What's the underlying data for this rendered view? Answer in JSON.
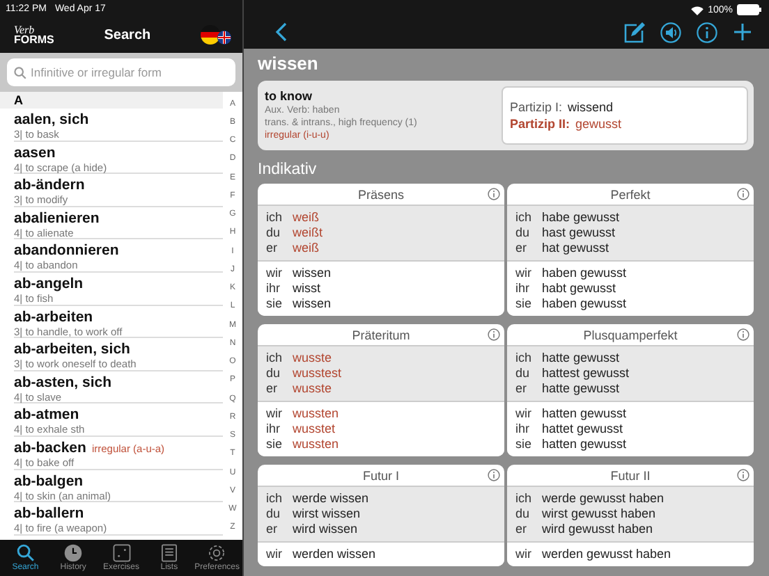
{
  "status_bar": {
    "time": "11:22 PM",
    "date": "Wed Apr 17",
    "battery": "100%"
  },
  "sidebar": {
    "logo_top": "Verb",
    "logo_bottom": "FORMS",
    "title": "Search",
    "search": {
      "placeholder": "Infinitive or irregular form"
    },
    "section": "A",
    "items": [
      {
        "verb": "aalen, sich",
        "meaning": "3| to bask",
        "selected": false
      },
      {
        "verb": "aasen",
        "meaning": "4| to scrape (a hide)",
        "selected": false
      },
      {
        "verb": "ab-ändern",
        "meaning": "3| to modify",
        "selected": false
      },
      {
        "verb": "abalienieren",
        "meaning": "4| to alienate",
        "selected": false
      },
      {
        "verb": "abandonnieren",
        "meaning": "4| to abandon",
        "selected": false
      },
      {
        "verb": "ab-angeln",
        "meaning": "4| to fish",
        "selected": false
      },
      {
        "verb": "ab-arbeiten",
        "meaning": "3| to handle, to work off",
        "selected": false
      },
      {
        "verb": "ab-arbeiten, sich",
        "meaning": "3| to work oneself to death",
        "selected": false
      },
      {
        "verb": "ab-asten, sich",
        "meaning": "4| to slave",
        "selected": false
      },
      {
        "verb": "ab-atmen",
        "meaning": "4| to exhale sth",
        "selected": false
      },
      {
        "verb": "ab-backen",
        "tag": "irregular (a-u-a)",
        "meaning": "4| to bake off",
        "selected": false
      },
      {
        "verb": "ab-balgen",
        "meaning": "4| to skin (an animal)",
        "selected": false
      },
      {
        "verb": "ab-ballern",
        "meaning": "4| to fire (a weapon)",
        "selected": false
      }
    ],
    "index": [
      "A",
      "B",
      "C",
      "D",
      "E",
      "F",
      "G",
      "H",
      "I",
      "J",
      "K",
      "L",
      "M",
      "N",
      "O",
      "P",
      "Q",
      "R",
      "S",
      "T",
      "U",
      "V",
      "W",
      "Z"
    ]
  },
  "tab_bar": [
    {
      "label": "Search",
      "kind": "search",
      "selected": true
    },
    {
      "label": "History",
      "kind": "history",
      "selected": false
    },
    {
      "label": "Exercises",
      "kind": "exercises",
      "selected": false
    },
    {
      "label": "Lists",
      "kind": "lists",
      "selected": false
    },
    {
      "label": "Preferences",
      "kind": "preferences",
      "selected": false
    }
  ],
  "detail": {
    "verb": "wissen",
    "meaning": "to know",
    "aux": "Aux. Verb: haben",
    "usage": "trans. & intrans., high frequency (1)",
    "irregular": "irregular (i-u-u)",
    "participles": [
      {
        "label": "Partizip I:",
        "form": "wissend",
        "irregular": false
      },
      {
        "label": "Partizip II:",
        "form": "gewusst",
        "irregular": true
      }
    ],
    "mood": "Indikativ",
    "tenses": [
      {
        "name": "Präsens",
        "groups": [
          [
            {
              "p": "ich",
              "f": "weiß",
              "irregular": true
            },
            {
              "p": "du",
              "f": "weißt",
              "irregular": true
            },
            {
              "p": "er",
              "f": "weiß",
              "irregular": true
            }
          ],
          [
            {
              "p": "wir",
              "f": "wissen",
              "irregular": false
            },
            {
              "p": "ihr",
              "f": "wisst",
              "irregular": false
            },
            {
              "p": "sie",
              "f": "wissen",
              "irregular": false
            }
          ]
        ]
      },
      {
        "name": "Perfekt",
        "groups": [
          [
            {
              "p": "ich",
              "f": "habe gewusst",
              "irregular": false
            },
            {
              "p": "du",
              "f": "hast gewusst",
              "irregular": false
            },
            {
              "p": "er",
              "f": "hat gewusst",
              "irregular": false
            }
          ],
          [
            {
              "p": "wir",
              "f": "haben gewusst",
              "irregular": false
            },
            {
              "p": "ihr",
              "f": "habt gewusst",
              "irregular": false
            },
            {
              "p": "sie",
              "f": "haben gewusst",
              "irregular": false
            }
          ]
        ]
      },
      {
        "name": "Präteritum",
        "groups": [
          [
            {
              "p": "ich",
              "f": "wusste",
              "irregular": true
            },
            {
              "p": "du",
              "f": "wusstest",
              "irregular": true
            },
            {
              "p": "er",
              "f": "wusste",
              "irregular": true
            }
          ],
          [
            {
              "p": "wir",
              "f": "wussten",
              "irregular": true
            },
            {
              "p": "ihr",
              "f": "wusstet",
              "irregular": true
            },
            {
              "p": "sie",
              "f": "wussten",
              "irregular": true
            }
          ]
        ]
      },
      {
        "name": "Plusquamperfekt",
        "groups": [
          [
            {
              "p": "ich",
              "f": "hatte gewusst",
              "irregular": false
            },
            {
              "p": "du",
              "f": "hattest gewusst",
              "irregular": false
            },
            {
              "p": "er",
              "f": "hatte gewusst",
              "irregular": false
            }
          ],
          [
            {
              "p": "wir",
              "f": "hatten gewusst",
              "irregular": false
            },
            {
              "p": "ihr",
              "f": "hattet gewusst",
              "irregular": false
            },
            {
              "p": "sie",
              "f": "hatten gewusst",
              "irregular": false
            }
          ]
        ]
      },
      {
        "name": "Futur I",
        "groups": [
          [
            {
              "p": "ich",
              "f": "werde wissen",
              "irregular": false
            },
            {
              "p": "du",
              "f": "wirst wissen",
              "irregular": false
            },
            {
              "p": "er",
              "f": "wird wissen",
              "irregular": false
            }
          ],
          [
            {
              "p": "wir",
              "f": "werden wissen",
              "irregular": false
            }
          ]
        ]
      },
      {
        "name": "Futur II",
        "groups": [
          [
            {
              "p": "ich",
              "f": "werde gewusst haben",
              "irregular": false
            },
            {
              "p": "du",
              "f": "wirst gewusst haben",
              "irregular": false
            },
            {
              "p": "er",
              "f": "wird gewusst haben",
              "irregular": false
            }
          ],
          [
            {
              "p": "wir",
              "f": "werden gewusst haben",
              "irregular": false
            }
          ]
        ]
      }
    ]
  }
}
